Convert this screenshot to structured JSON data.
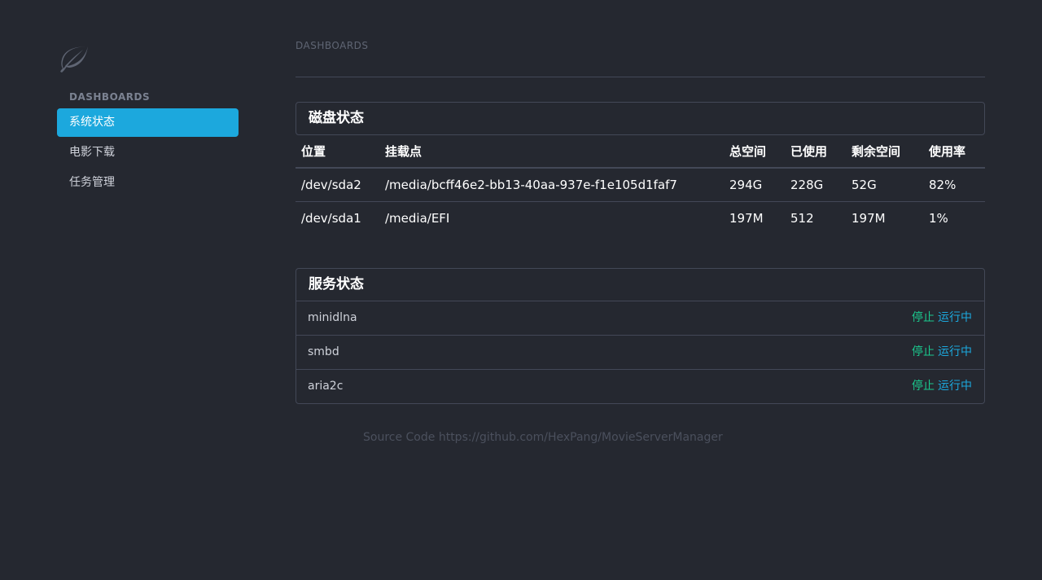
{
  "sidebar": {
    "logo_icon": "leaf-icon",
    "heading": "DASHBOARDS",
    "items": [
      {
        "label": "系统状态",
        "active": true
      },
      {
        "label": "电影下载",
        "active": false
      },
      {
        "label": "任务管理",
        "active": false
      }
    ]
  },
  "main": {
    "header": "DASHBOARDS",
    "disk_panel": {
      "title": "磁盘状态",
      "columns": [
        "位置",
        "挂载点",
        "总空间",
        "已使用",
        "剩余空间",
        "使用率"
      ],
      "rows": [
        [
          "/dev/sda2",
          "/media/bcff46e2-bb13-40aa-937e-f1e105d1faf7",
          "294G",
          "228G",
          "52G",
          "82%"
        ],
        [
          "/dev/sda1",
          "/media/EFI",
          "197M",
          "512",
          "197M",
          "1%"
        ]
      ]
    },
    "service_panel": {
      "title": "服务状态",
      "services": [
        {
          "name": "minidlna",
          "stop_label": "停止",
          "status_label": "运行中"
        },
        {
          "name": "smbd",
          "stop_label": "停止",
          "status_label": "运行中"
        },
        {
          "name": "aria2c",
          "stop_label": "停止",
          "status_label": "运行中"
        }
      ]
    }
  },
  "footer": {
    "text": "Source Code https://github.com/HexPang/MovieServerManager"
  },
  "colors": {
    "background": "#252830",
    "accent": "#1ca8dd",
    "success": "#1bc98e",
    "border": "#434857"
  }
}
